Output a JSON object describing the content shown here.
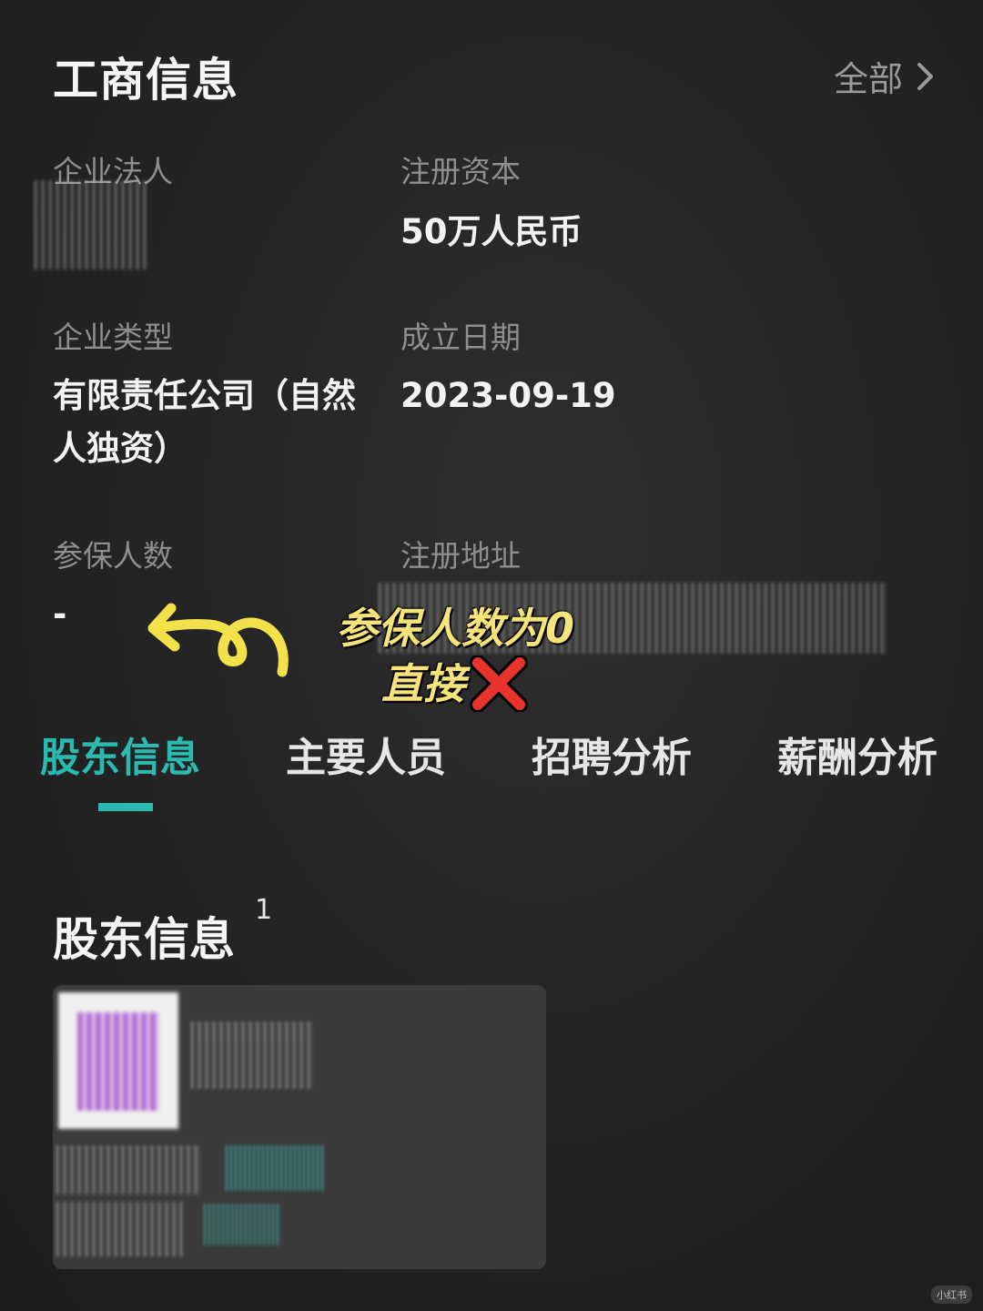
{
  "header": {
    "title": "工商信息",
    "all_label": "全部"
  },
  "info": {
    "legal_person_label": "企业法人",
    "capital_label": "注册资本",
    "capital_value": "50万人民币",
    "type_label": "企业类型",
    "type_value": "有限责任公司（自然人独资）",
    "date_label": "成立日期",
    "date_value": "2023-09-19",
    "insured_label": "参保人数",
    "insured_value": "-",
    "address_label": "注册地址"
  },
  "annotation": {
    "line1": "参保人数为0",
    "line2": "直接",
    "arrow_color": "#f2e14a",
    "cross_color": "#e8332c"
  },
  "tabs": [
    {
      "label": "股东信息",
      "active": true
    },
    {
      "label": "主要人员",
      "active": false
    },
    {
      "label": "招聘分析",
      "active": false
    },
    {
      "label": "薪酬分析",
      "active": false
    }
  ],
  "shareholders": {
    "title": "股东信息",
    "count": "1"
  },
  "colors": {
    "accent": "#2bb9b0",
    "background": "#262626"
  },
  "watermark": "小红书"
}
